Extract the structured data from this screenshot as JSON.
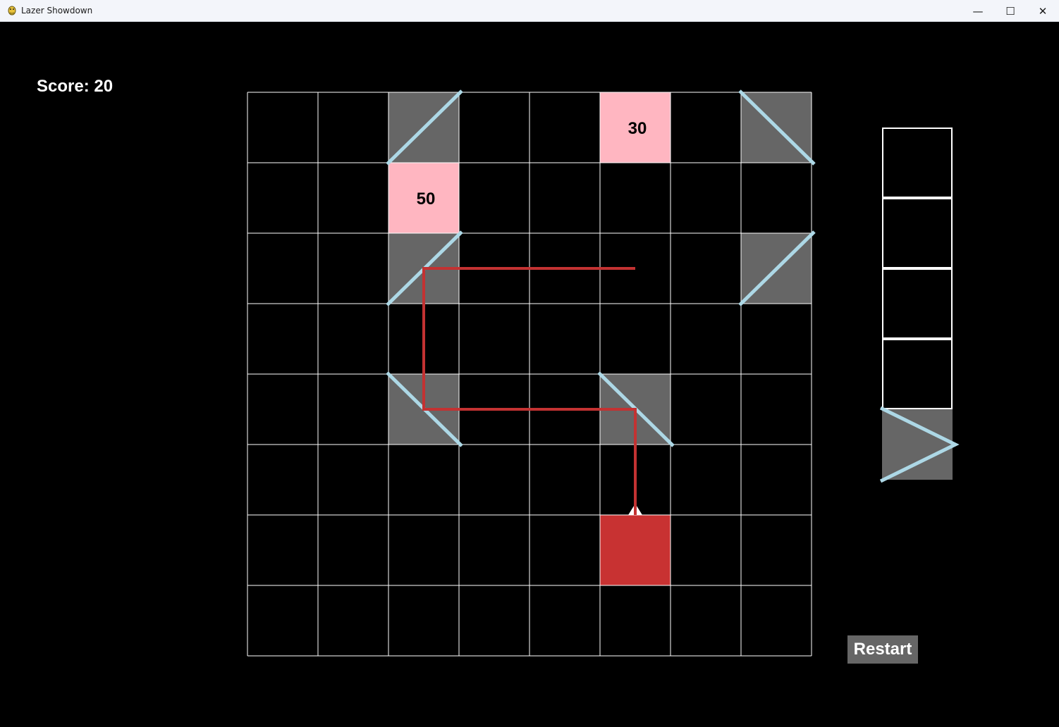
{
  "window": {
    "title": "Lazer Showdown",
    "minimize_glyph": "—",
    "maximize_glyph": "☐",
    "close_glyph": "✕"
  },
  "score": {
    "label": "Score: 20"
  },
  "restart": {
    "label": "Restart"
  },
  "colors": {
    "background": "#000000",
    "grid_line": "#ffffff",
    "mirror_fill": "#666666",
    "mirror_line": "#add8e6",
    "target_fill": "#ffb6c1",
    "laser": "#c33232",
    "emitter": "#c83232",
    "arrow": "#ffffff"
  },
  "board": {
    "rows": 8,
    "cols": 8,
    "mirrors": [
      {
        "row": 0,
        "col": 2,
        "orientation": "slash"
      },
      {
        "row": 0,
        "col": 7,
        "orientation": "backslash"
      },
      {
        "row": 2,
        "col": 2,
        "orientation": "slash"
      },
      {
        "row": 2,
        "col": 7,
        "orientation": "slash"
      },
      {
        "row": 4,
        "col": 2,
        "orientation": "backslash"
      },
      {
        "row": 4,
        "col": 5,
        "orientation": "backslash"
      }
    ],
    "targets": [
      {
        "row": 0,
        "col": 5,
        "value": "30"
      },
      {
        "row": 1,
        "col": 2,
        "value": "50"
      }
    ],
    "emitter": {
      "row": 6,
      "col": 5,
      "direction": "up"
    },
    "laser_path": [
      {
        "row": 6,
        "col": 5
      },
      {
        "row": 4,
        "col": 5
      },
      {
        "row": 4,
        "col": 2
      },
      {
        "row": 2,
        "col": 2
      },
      {
        "row": 2,
        "col": 5
      }
    ]
  },
  "inventory": {
    "slots": 5,
    "items": [
      {
        "slot": 4,
        "type": "mirror",
        "shape": "chevron-right"
      }
    ]
  }
}
